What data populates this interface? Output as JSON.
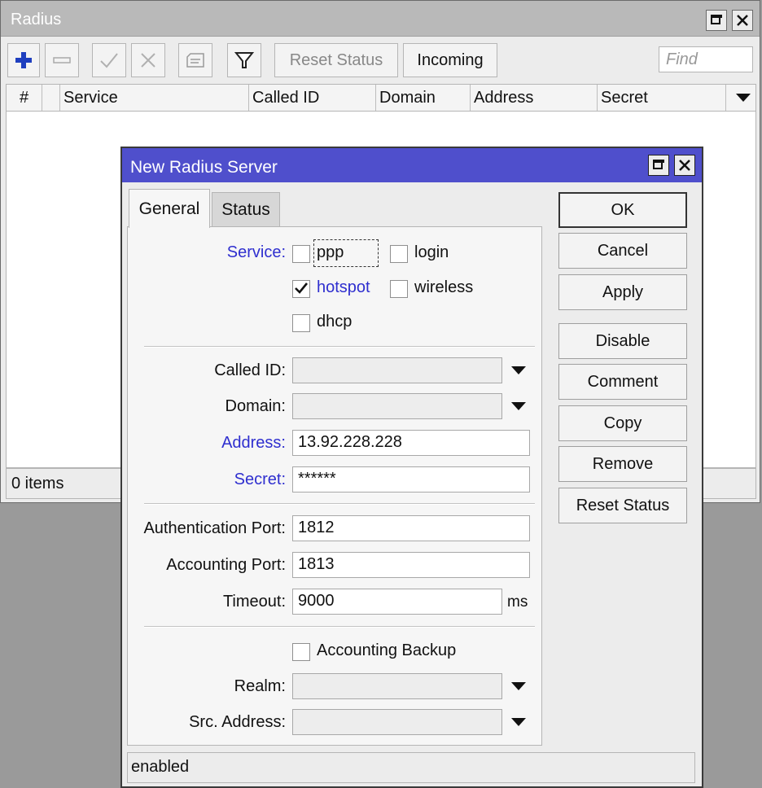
{
  "list_window": {
    "title": "Radius",
    "toolbar": {
      "add_icon": "plus-icon",
      "remove_icon": "minus-icon",
      "enable_icon": "check-icon",
      "disable_icon": "cross-icon",
      "comment_icon": "note-icon",
      "filter_icon": "filter-icon",
      "reset_status_label": "Reset Status",
      "incoming_label": "Incoming",
      "find_placeholder": "Find"
    },
    "columns": [
      "#",
      "Service",
      "Called ID",
      "Domain",
      "Address",
      "Secret"
    ],
    "status": "0 items"
  },
  "dialog": {
    "title": "New Radius Server",
    "tabs": [
      {
        "label": "General",
        "active": true
      },
      {
        "label": "Status",
        "active": false
      }
    ],
    "service": {
      "label": "Service:",
      "options": [
        {
          "label": "ppp",
          "checked": false
        },
        {
          "label": "login",
          "checked": false
        },
        {
          "label": "hotspot",
          "checked": true
        },
        {
          "label": "wireless",
          "checked": false
        },
        {
          "label": "dhcp",
          "checked": false
        }
      ]
    },
    "called_id": {
      "label": "Called ID:",
      "value": ""
    },
    "domain": {
      "label": "Domain:",
      "value": ""
    },
    "address": {
      "label": "Address:",
      "value": "13.92.228.228"
    },
    "secret": {
      "label": "Secret:",
      "value": "******"
    },
    "auth_port": {
      "label": "Authentication Port:",
      "value": "1812"
    },
    "acct_port": {
      "label": "Accounting Port:",
      "value": "1813"
    },
    "timeout": {
      "label": "Timeout:",
      "value": "9000",
      "unit": "ms"
    },
    "accounting_backup": {
      "label": "Accounting Backup",
      "checked": false
    },
    "realm": {
      "label": "Realm:",
      "value": ""
    },
    "src_address": {
      "label": "Src. Address:",
      "value": ""
    },
    "buttons": {
      "ok": "OK",
      "cancel": "Cancel",
      "apply": "Apply",
      "disable": "Disable",
      "comment": "Comment",
      "copy": "Copy",
      "remove": "Remove",
      "reset_status": "Reset Status"
    },
    "status": "enabled"
  },
  "colors": {
    "dialog_titlebar": "#4f4fcc",
    "required_label": "#2f2fcf",
    "add_icon": "#1f3fbf"
  }
}
